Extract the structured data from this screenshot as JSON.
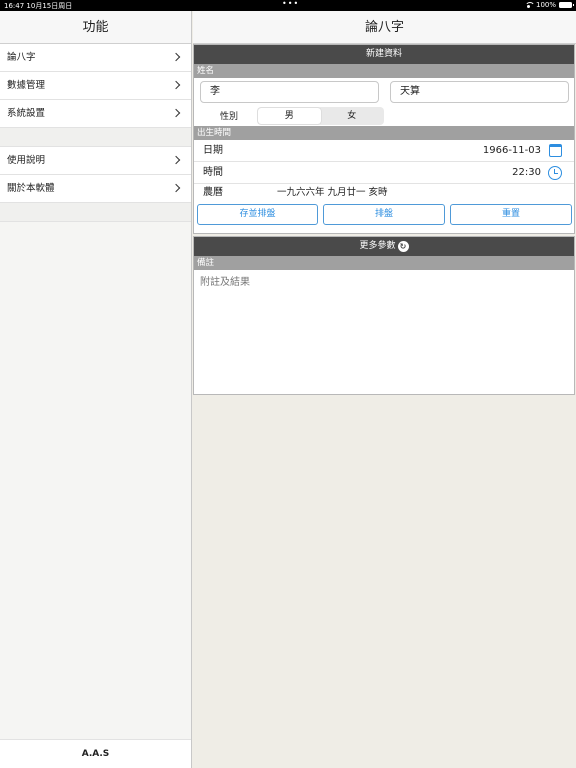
{
  "status_bar": {
    "time": "16:47",
    "date": "10月15日周日",
    "dots": "•••",
    "battery": "100%"
  },
  "sidebar": {
    "title": "功能",
    "group1": [
      {
        "label": "論八字"
      },
      {
        "label": "數據管理"
      },
      {
        "label": "系統設置"
      }
    ],
    "group2": [
      {
        "label": "使用說明"
      },
      {
        "label": "關於本軟體"
      }
    ],
    "footer": "A.A.S"
  },
  "main": {
    "title": "論八字",
    "new_record": {
      "title": "新建資料",
      "name_section": "姓名",
      "surname": "李",
      "given_name": "天算",
      "gender_label": "性別",
      "gender_options": [
        "男",
        "女"
      ],
      "gender_selected": "男",
      "birth_section": "出生時間",
      "date_label": "日期",
      "date_value": "1966-11-03",
      "time_label": "時間",
      "time_value": "22:30",
      "lunar_label": "農曆",
      "lunar_value": "一九六六年 九月廿一 亥時",
      "buttons": {
        "save": "存並排盤",
        "chart": "排盤",
        "reset": "重置"
      }
    },
    "more_params": {
      "title": "更多參數",
      "notes_section": "備註",
      "notes_placeholder": "附註及結果"
    }
  },
  "colors": {
    "accent": "#2d8ee0",
    "panel_title_bg": "#4a4a4a",
    "section_bar_bg": "#a0a0a0"
  }
}
